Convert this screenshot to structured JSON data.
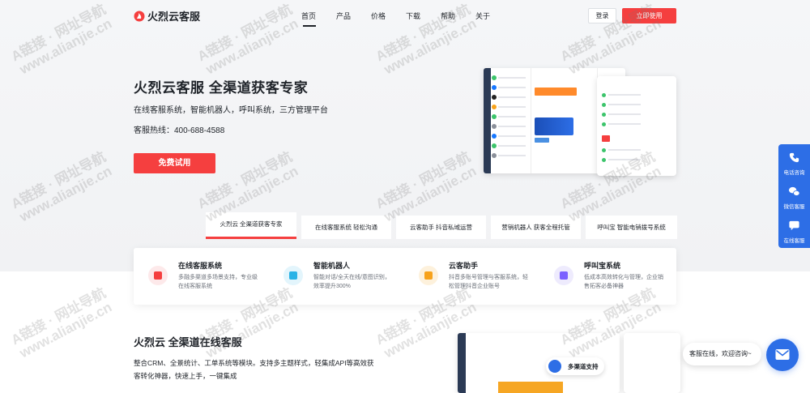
{
  "brand": {
    "name": "火烈云客服",
    "accent": "#f53f3f",
    "blue": "#2d6ee6"
  },
  "nav": {
    "links": [
      "首页",
      "产品",
      "价格",
      "下载",
      "帮助",
      "关于"
    ],
    "active": "首页",
    "login": "登录",
    "cta": "立即使用"
  },
  "hero": {
    "title": "火烈云客服 全渠道获客专家",
    "subtitle": "在线客服系统，智能机器人，呼叫系统，三方管理平台",
    "hotline": "客服热线：400-688-4588",
    "cta": "免费试用"
  },
  "tabs": [
    {
      "label": "火烈云 全渠道获客专家",
      "active": true
    },
    {
      "label": "在线客服系统 轻松沟通",
      "active": false
    },
    {
      "label": "云客助手 抖音私域运营",
      "active": false
    },
    {
      "label": "营销机器人 获客全程托管",
      "active": false
    },
    {
      "label": "呼叫宝 智能电销拨号系统",
      "active": false
    }
  ],
  "features": [
    {
      "title": "在线客服系统",
      "desc": "多融多渠道多场景支持，专业级在线客服系统",
      "icon": "chat-bubble-icon",
      "color": "#f53f3f",
      "bg": "#fde9ea"
    },
    {
      "title": "智能机器人",
      "desc": "智能对话/全天在线/意图识别，效率提升300%",
      "icon": "robot-icon",
      "color": "#2bb3e6",
      "bg": "#e3f5fc"
    },
    {
      "title": "云客助手",
      "desc": "抖音多账号管理与客服系统，轻松管理抖音企业账号",
      "icon": "assistant-icon",
      "color": "#f7a21b",
      "bg": "#fdf1dc"
    },
    {
      "title": "呼叫宝系统",
      "desc": "低成本高效转化与管理，企业销售拓客必备神器",
      "icon": "phone-icon",
      "color": "#7b61ff",
      "bg": "#eeebfd"
    }
  ],
  "section2": {
    "title": "火烈云 全渠道在线客服",
    "desc": "整合CRM、全景统计、工单系统等模块。支持多主题样式，轻集成API等高效获客转化神器，快速上手，一键集成",
    "pill": "多渠道支持"
  },
  "sidefloat": [
    {
      "label": "电话咨询",
      "icon": "phone-icon"
    },
    {
      "label": "微信客服",
      "icon": "wechat-icon"
    },
    {
      "label": "在线客服",
      "icon": "chat-icon"
    }
  ],
  "chat": {
    "bubble": "客服在线，欢迎咨询~",
    "icon": "mail-icon"
  },
  "watermark": {
    "line1": "A链接 · 网址导航",
    "line2": "www.alianjie.cn"
  }
}
